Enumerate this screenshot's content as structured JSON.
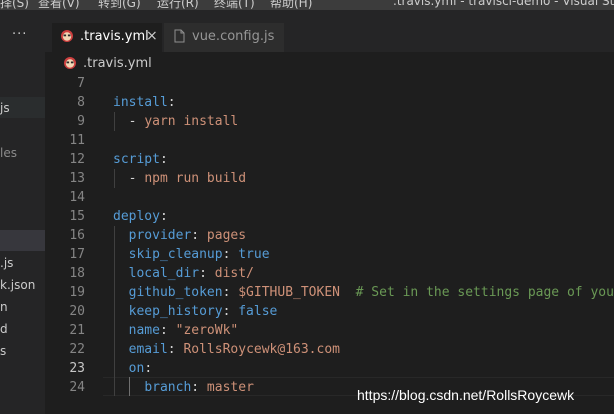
{
  "menubar": {
    "items": [
      "择(S)",
      "查看(V)",
      "转到(G)",
      "运行(R)",
      "终端(T)",
      "帮助(H)"
    ],
    "window_title": ".travis.yml - travisci-demo - Visual Studio C"
  },
  "sidebar": {
    "more_label": "···",
    "items": [
      "js",
      "les",
      ".js",
      "k.json",
      "n",
      "d",
      "s"
    ]
  },
  "tabs": [
    {
      "label": ".travis.yml",
      "icon": "travis-icon",
      "active": true,
      "close": "×"
    },
    {
      "label": "vue.config.js",
      "icon": "file-icon",
      "active": false
    }
  ],
  "breadcrumb": {
    "label": ".travis.yml",
    "icon": "travis-icon"
  },
  "editor": {
    "current_line": 23,
    "lines": [
      {
        "num": "7",
        "text": ""
      },
      {
        "num": "8",
        "text": "install:"
      },
      {
        "num": "9",
        "text": "  - yarn install"
      },
      {
        "num": "11",
        "text": ""
      },
      {
        "num": "12",
        "text": "script:"
      },
      {
        "num": "13",
        "text": "  - npm run build"
      },
      {
        "num": "14",
        "text": ""
      },
      {
        "num": "15",
        "text": "deploy:"
      },
      {
        "num": "16",
        "text": "  provider: pages"
      },
      {
        "num": "17",
        "text": "  skip_cleanup: true"
      },
      {
        "num": "18",
        "text": "  local_dir: dist/"
      },
      {
        "num": "19",
        "text": "  github_token: $GITHUB_TOKEN  # Set in the settings page of your"
      },
      {
        "num": "20",
        "text": "  keep_history: false"
      },
      {
        "num": "21",
        "text": "  name: \"zeroWk\""
      },
      {
        "num": "22",
        "text": "  email: RollsRoycewk@163.com"
      },
      {
        "num": "23",
        "text": "  on:"
      },
      {
        "num": "24",
        "text": "    branch: master"
      }
    ]
  },
  "watermark": "https://blog.csdn.net/RollsRoycewk",
  "colors": {
    "background": "#1e1e1e",
    "key": "#569cd6",
    "string": "#ce9178",
    "comment": "#6a9955",
    "line_number": "#858585"
  }
}
